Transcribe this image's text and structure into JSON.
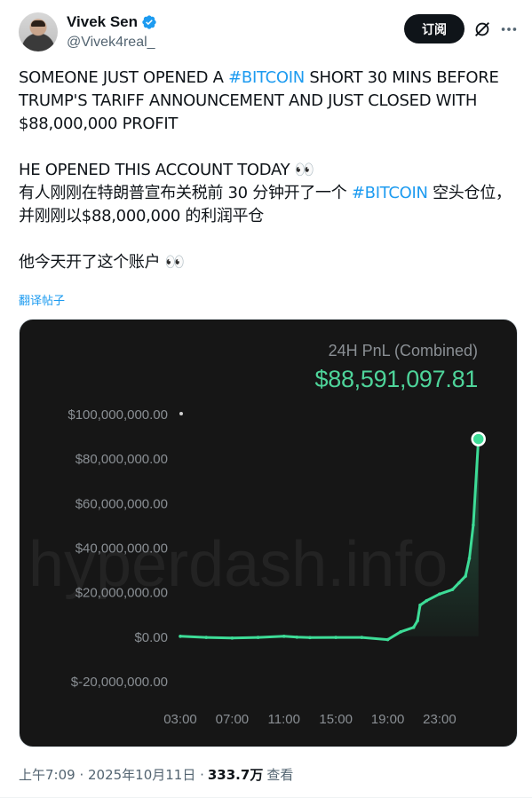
{
  "author": {
    "display_name": "Vivek Sen",
    "handle": "@Vivek4real_",
    "verified": true
  },
  "actions": {
    "subscribe_label": "订阅",
    "grok_icon": "grok-icon",
    "more_icon": "more-icon"
  },
  "tweet": {
    "en_line1_pre": "SOMEONE JUST OPENED A ",
    "en_hashtag": "#BITCOIN",
    "en_line1_post": " SHORT 30 MINS BEFORE TRUMP'S TARIFF ANNOUNCEMENT AND JUST CLOSED WITH $88,000,000 PROFIT",
    "en_line2": "HE OPENED THIS ACCOUNT TODAY 👀",
    "zh_line1_pre": "有人刚刚在特朗普宣布关税前 30 分钟开了一个 ",
    "zh_hashtag": "#BITCOIN",
    "zh_line1_post": " 空头仓位，并刚刚以$88,000,000 的利润平仓",
    "zh_line2": "他今天开了这个账户 👀",
    "translate_label": "翻译帖子"
  },
  "meta": {
    "time": "上午7:09 · 2025年10月11日 · ",
    "views": "333.7万",
    "views_label": "查看"
  },
  "colors": {
    "accent": "#1d9bf0",
    "chart_line": "#3ddc97",
    "chart_bg": "#161616"
  },
  "chart_data": {
    "type": "area",
    "title": "24H PnL (Combined)",
    "headline_value": "$88,591,097.81",
    "watermark": "hyperdash.info",
    "y_ticks": [
      "$100,000,000.00",
      "$80,000,000.00",
      "$60,000,000.00",
      "$40,000,000.00",
      "$20,000,000.00",
      "$0.00",
      "$-20,000,000.00"
    ],
    "y_tick_values": [
      100000000,
      80000000,
      60000000,
      40000000,
      20000000,
      0,
      -20000000
    ],
    "x_ticks": [
      "03:00",
      "07:00",
      "11:00",
      "15:00",
      "19:00",
      "23:00"
    ],
    "x_tick_values": [
      3,
      7,
      11,
      15,
      19,
      23
    ],
    "ylim": [
      -20000000,
      100000000
    ],
    "xlim": [
      3,
      26.5
    ],
    "series": [
      {
        "x": [
          3,
          5,
          7,
          9,
          11,
          12,
          13,
          15,
          17,
          19,
          20,
          21,
          21.3,
          21.5,
          22,
          23,
          24,
          24.5,
          25,
          25.3,
          25.6,
          26
        ],
        "values": [
          0,
          -500000,
          -800000,
          -500000,
          0,
          -400000,
          -600000,
          -500000,
          -500000,
          -1500000,
          2000000,
          4000000,
          7000000,
          14000000,
          16000000,
          19000000,
          21000000,
          24000000,
          27000000,
          35000000,
          50000000,
          88591097.81
        ]
      }
    ]
  }
}
